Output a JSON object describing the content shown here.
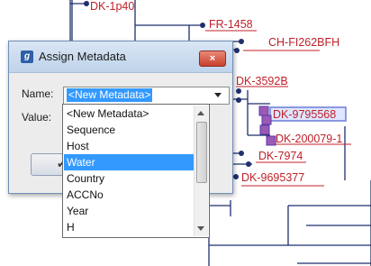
{
  "tree": {
    "labels": [
      "DK-1p40",
      "FR-1458",
      "CH-FI262BFH",
      "DK-3592B",
      "DK-9795568",
      "DK-200079-1",
      "DK-7974",
      "DK-9695377"
    ]
  },
  "colors": {
    "tree_branch": "#1f2f6e",
    "tree_label": "#c0202a",
    "selection": "#3399ff"
  },
  "dialog": {
    "title": "Assign Metadata",
    "close_icon": "×",
    "name_label": "Name:",
    "name_value": "<New Metadata>",
    "value_label": "Value:",
    "ok_icon": "✔"
  },
  "dropdown": {
    "items": [
      "<New Metadata>",
      "Sequence",
      "Host",
      "Water",
      "Country",
      "ACCNo",
      "Year",
      "H"
    ],
    "selected": "Water"
  }
}
